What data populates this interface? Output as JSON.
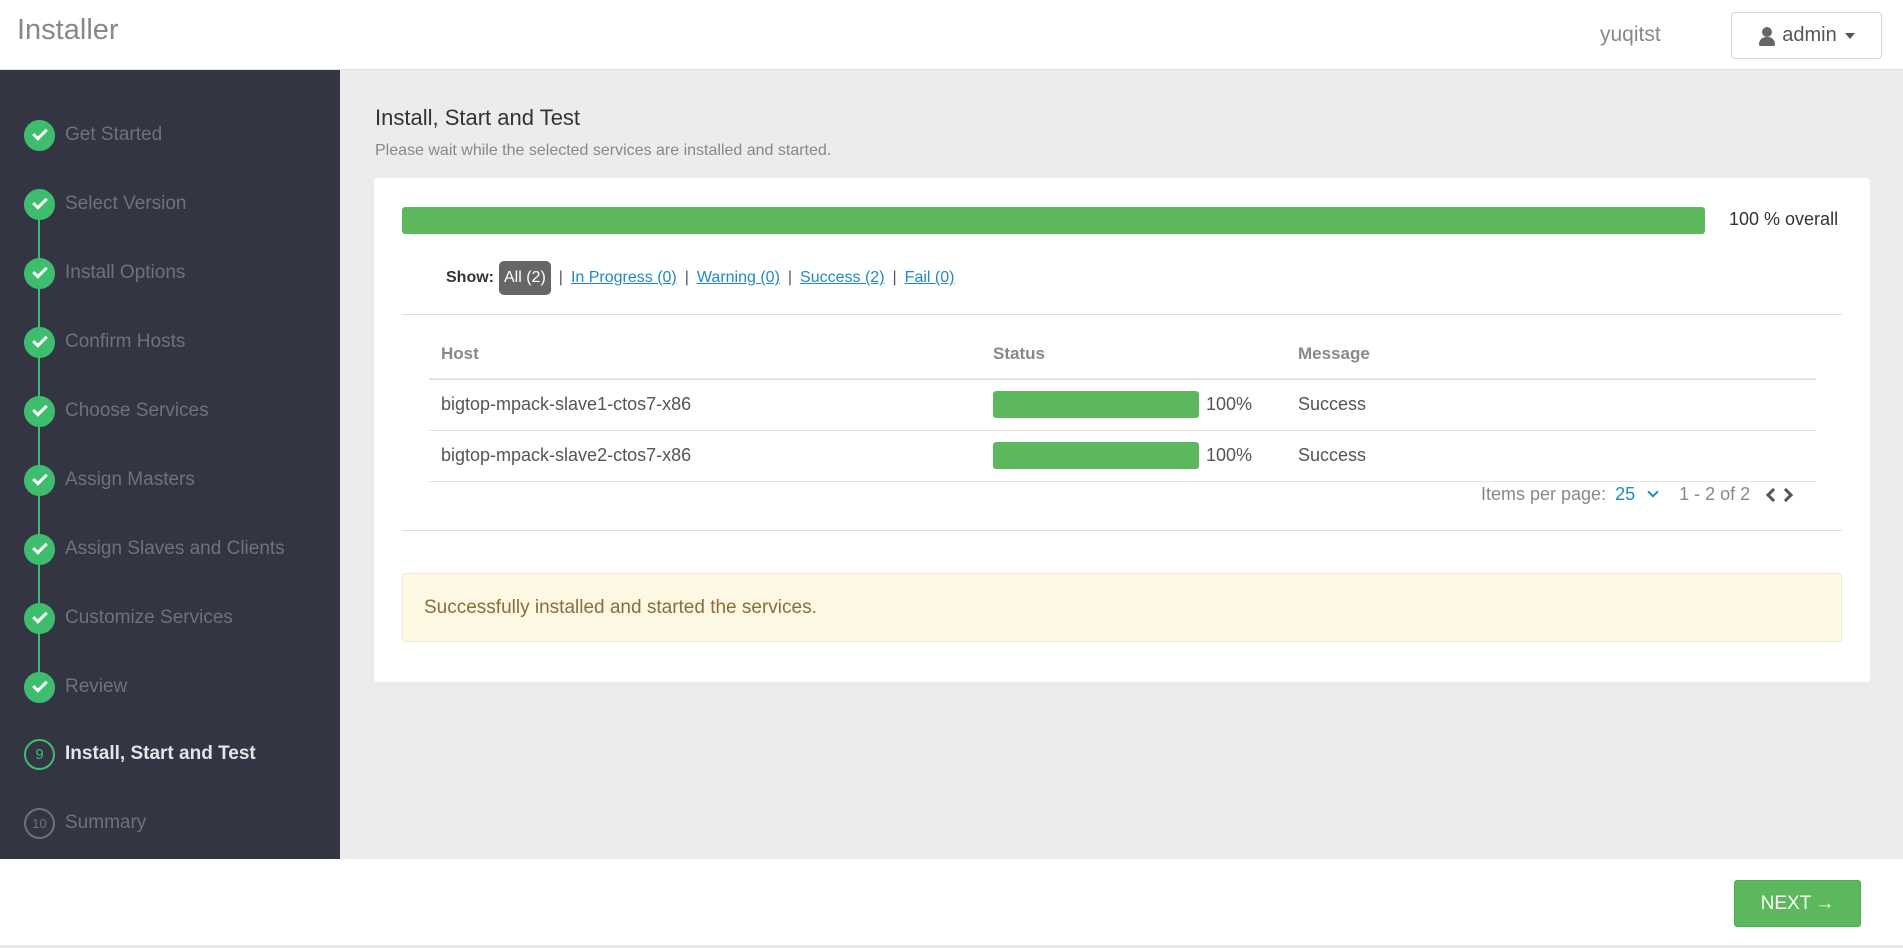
{
  "header": {
    "app_title": "Installer",
    "cluster_name": "yuqitst",
    "user_label": "admin"
  },
  "sidebar": {
    "steps": [
      {
        "label": "Get Started",
        "state": "done"
      },
      {
        "label": "Select Version",
        "state": "done"
      },
      {
        "label": "Install Options",
        "state": "done"
      },
      {
        "label": "Confirm Hosts",
        "state": "done"
      },
      {
        "label": "Choose Services",
        "state": "done"
      },
      {
        "label": "Assign Masters",
        "state": "done"
      },
      {
        "label": "Assign Slaves and Clients",
        "state": "done"
      },
      {
        "label": "Customize Services",
        "state": "done"
      },
      {
        "label": "Review",
        "state": "done"
      },
      {
        "label": "Install, Start and Test",
        "state": "current",
        "number": "9"
      },
      {
        "label": "Summary",
        "state": "future",
        "number": "10"
      }
    ]
  },
  "main": {
    "title": "Install, Start and Test",
    "subtitle": "Please wait while the selected services are installed and started.",
    "overall_progress": 100,
    "overall_label": "100 % overall",
    "filters": {
      "show_label": "Show:",
      "all": "All (2)",
      "in_progress": "In Progress (0)",
      "warning": "Warning (0)",
      "success": "Success (2)",
      "fail": "Fail (0)",
      "separator": "|"
    },
    "table": {
      "headers": {
        "host": "Host",
        "status": "Status",
        "message": "Message"
      },
      "rows": [
        {
          "host": "bigtop-mpack-slave1-ctos7-x86",
          "progress": 100,
          "percent_label": "100%",
          "message": "Success"
        },
        {
          "host": "bigtop-mpack-slave2-ctos7-x86",
          "progress": 100,
          "percent_label": "100%",
          "message": "Success"
        }
      ]
    },
    "pagination": {
      "items_per_page_label": "Items per page:",
      "items_per_page_value": "25",
      "range": "1 - 2 of 2"
    },
    "alert_message": "Successfully installed and started the services."
  },
  "footer": {
    "next_label": "NEXT",
    "next_arrow": "→"
  },
  "colors": {
    "accent_green": "#3dbd6d",
    "progress_green": "#5cb85c",
    "link_blue": "#1f89c7",
    "sidebar_bg": "#333642"
  }
}
